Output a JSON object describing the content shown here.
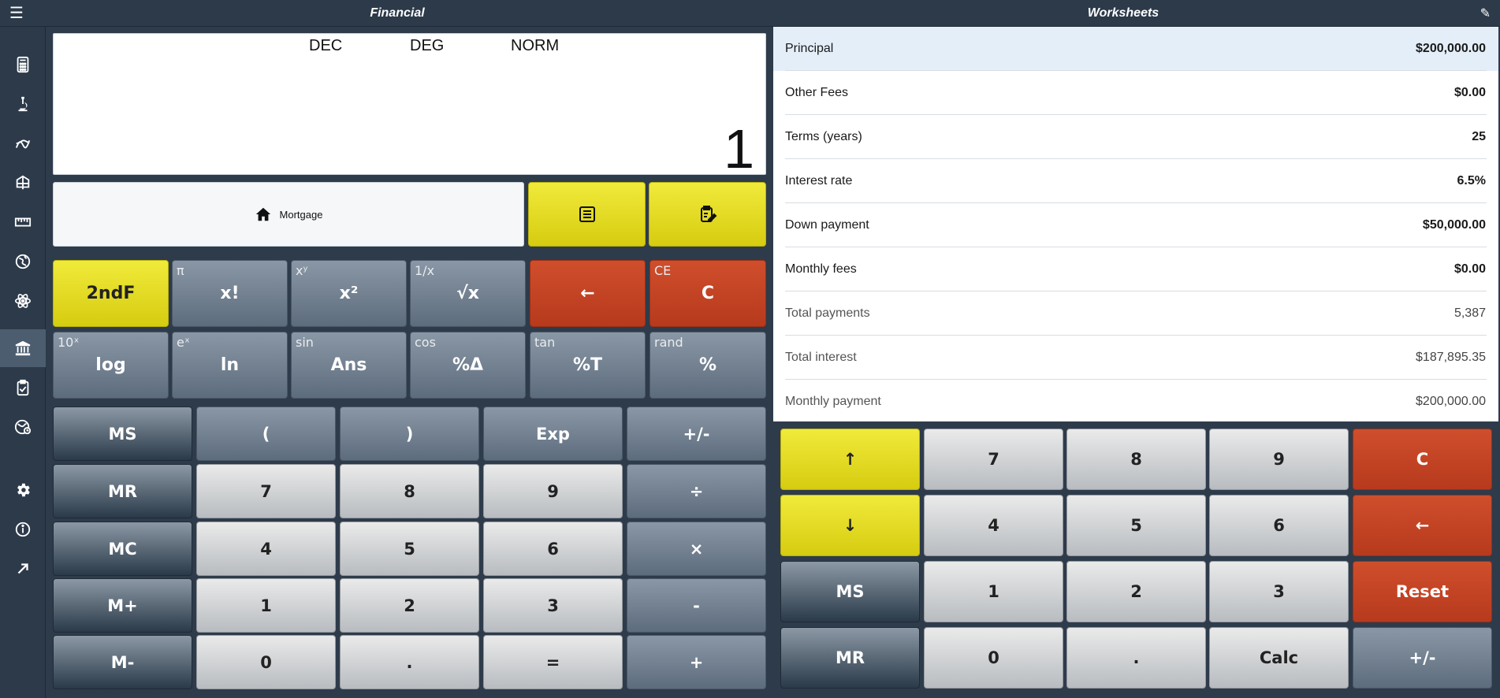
{
  "header": {
    "left_title": "Financial",
    "right_title": "Worksheets",
    "menu_icon": "hamburger-icon",
    "edit_icon": "pen-icon"
  },
  "sidebar": {
    "items": [
      {
        "icon": "calculator-icon"
      },
      {
        "icon": "microscope-icon"
      },
      {
        "icon": "graph-icon"
      },
      {
        "icon": "network-icon"
      },
      {
        "icon": "ruler-icon"
      },
      {
        "icon": "globe-icon"
      },
      {
        "icon": "atom-icon"
      },
      {
        "icon": "bank-icon",
        "active": true
      },
      {
        "icon": "clipboard-icon"
      },
      {
        "icon": "globe-clock-icon"
      },
      {
        "icon": "gear-icon"
      },
      {
        "icon": "info-icon"
      },
      {
        "icon": "expand-icon"
      }
    ]
  },
  "display": {
    "mode_base": "DEC",
    "mode_angle": "DEG",
    "mode_format": "NORM",
    "value": "1"
  },
  "worksheet_bar": {
    "name": "Mortgage",
    "icon": "home-icon",
    "list_icon": "list-icon",
    "edit_icon": "clipboard-edit-icon"
  },
  "calc_keys": {
    "row1": [
      {
        "label": "2ndF",
        "sup": ""
      },
      {
        "label": "x!",
        "sup": "π"
      },
      {
        "label": "x²",
        "sup": "xʸ"
      },
      {
        "label": "√x",
        "sup": "1/x"
      },
      {
        "label": "←",
        "sup": ""
      },
      {
        "label": "C",
        "sup": "CE"
      }
    ],
    "row2": [
      {
        "label": "log",
        "sup": "10ˣ"
      },
      {
        "label": "ln",
        "sup": "eˣ"
      },
      {
        "label": "Ans",
        "sup": "sin"
      },
      {
        "label": "%Δ",
        "sup": "cos"
      },
      {
        "label": "%T",
        "sup": "tan"
      },
      {
        "label": "%",
        "sup": "rand"
      }
    ],
    "grid": [
      [
        "MS",
        "(",
        ")",
        "Exp",
        "+/-"
      ],
      [
        "MR",
        "7",
        "8",
        "9",
        "÷"
      ],
      [
        "MC",
        "4",
        "5",
        "6",
        "×"
      ],
      [
        "M+",
        "1",
        "2",
        "3",
        "-"
      ],
      [
        "M-",
        "0",
        ".",
        "=",
        "+"
      ]
    ]
  },
  "worksheet": {
    "rows": [
      {
        "label": "Principal",
        "value": "$200,000.00"
      },
      {
        "label": "Other Fees",
        "value": "$0.00"
      },
      {
        "label": "Terms (years)",
        "value": "25"
      },
      {
        "label": "Interest rate",
        "value": "6.5%"
      },
      {
        "label": "Down payment",
        "value": "$50,000.00"
      },
      {
        "label": "Monthly fees",
        "value": "$0.00"
      },
      {
        "label": "Total payments",
        "value": "5,387"
      },
      {
        "label": "Total interest",
        "value": "$187,895.35"
      },
      {
        "label": "Monthly payment",
        "value": "$200,000.00"
      }
    ]
  },
  "ws_keys": [
    [
      "↑",
      "7",
      "8",
      "9",
      "C"
    ],
    [
      "↓",
      "4",
      "5",
      "6",
      "←"
    ],
    [
      "MS",
      "1",
      "2",
      "3",
      "Reset"
    ],
    [
      "MR",
      "0",
      ".",
      "Calc",
      "+/-"
    ]
  ]
}
